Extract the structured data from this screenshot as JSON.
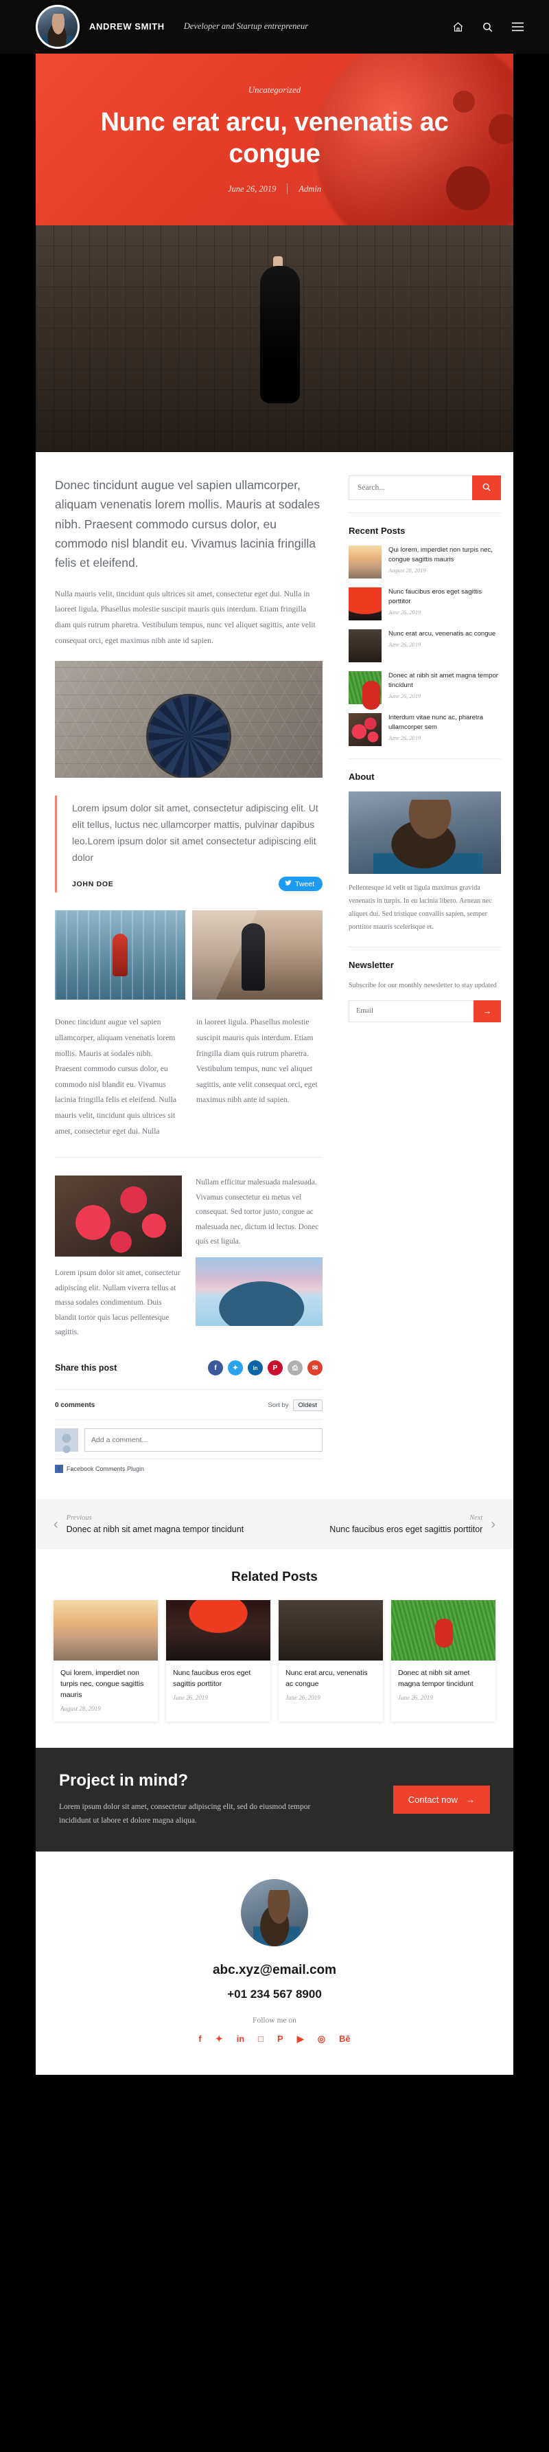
{
  "header": {
    "brand_name": "ANDREW SMITH",
    "brand_tagline": "Developer and Startup entrepreneur",
    "icons": {
      "home": "home-icon",
      "search": "search-icon",
      "menu": "hamburger-menu-icon"
    }
  },
  "hero": {
    "category": "Uncategorized",
    "title": "Nunc erat arcu, venenatis ac congue",
    "date": "June 26, 2019",
    "author": "Admin"
  },
  "article": {
    "lead": "Donec tincidunt augue vel sapien ullamcorper, aliquam venenatis lorem mollis. Mauris at sodales nibh. Praesent commodo cursus dolor, eu commodo nisl blandit eu. Vivamus lacinia fringilla felis et eleifend.",
    "para1": "Nulla mauris velit, tincidunt quis ultrices sit amet, consectetur eget dui. Nulla in laoreet ligula. Phasellus molestie suscipit mauris quis interdum. Etiam fringilla diam quis rutrum pharetra. Vestibulum tempus, nunc vel aliquet sagittis, ante velit consequat orci, eget maximus nibh ante id sapien.",
    "quote": "Lorem ipsum dolor sit amet, consectetur adipiscing elit. Ut elit tellus, luctus nec ullamcorper mattis, pulvinar dapibus leo.Lorem ipsum dolor sit amet consectetur adipiscing elit dolor",
    "quote_author": "JOHN DOE",
    "tweet_label": "Tweet",
    "col_left": "Donec tincidunt augue vel sapien ullamcorper, aliquam venenatis lorem mollis. Mauris at sodales nibh. Praesent commodo cursus dolor, eu commodo nisl blandit eu. Vivamus lacinia fringilla felis et eleifend. Nulla mauris velit, tincidunt quis ultrices sit amet, consectetur eget dui. Nulla",
    "col_right": "in laoreet ligula. Phasellus molestie suscipit mauris quis interdum. Etiam fringilla diam quis rutrum pharetra. Vestibulum tempus, nunc vel aliquet sagittis, ante velit consequat orci, eget maximus nibh ante id sapien.",
    "mac_caption": "Lorem ipsum dolor sit amet, consectetur adipiscing elit. Nullam viverra tellus at massa sodales condimentum. Duis blandit tortor quis lacus pellentesque sagittis.",
    "mac_right_text": "Nullam efficitur malesuada malesuada. Vivamus consectetur eu metus vel consequat. Sed tortor justo, congue ac malesuada nec, dictum id lectus. Donec quis est ligula.",
    "share_label": "Share this post",
    "share_icons": [
      {
        "name": "facebook-share-icon",
        "glyph": "f",
        "color": "#3b5998"
      },
      {
        "name": "twitter-share-icon",
        "glyph": "✦",
        "color": "#2aa3ef"
      },
      {
        "name": "linkedin-share-icon",
        "glyph": "in",
        "color": "#0a66a8"
      },
      {
        "name": "pinterest-share-icon",
        "glyph": "P",
        "color": "#c8102e"
      },
      {
        "name": "print-share-icon",
        "glyph": "⎙",
        "color": "#b0b0b0"
      },
      {
        "name": "email-share-icon",
        "glyph": "✉",
        "color": "#e0402c"
      }
    ]
  },
  "comments": {
    "count_label": "0 comments",
    "sort_label": "Sort by",
    "sort_value": "Oldest",
    "input_placeholder": "Add a comment...",
    "plugin_label": "Facebook Comments Plugin"
  },
  "prevnext": {
    "prev_kicker": "Previous",
    "prev_title": "Donec at nibh sit amet magna tempor tincidunt",
    "next_kicker": "Next",
    "next_title": "Nunc faucibus eros eget sagittis porttitor"
  },
  "related": {
    "heading": "Related Posts",
    "items": [
      {
        "title": "Qui lorem, imperdiet non turpis nec, congue sagittis mauris",
        "date": "August 28, 2019",
        "thumb": "th-beach"
      },
      {
        "title": "Nunc faucibus eros eget sagittis porttitor",
        "date": "June 26, 2019",
        "thumb": "th-metro"
      },
      {
        "title": "Nunc erat arcu, venenatis ac congue",
        "date": "June 26, 2019",
        "thumb": "th-girl"
      },
      {
        "title": "Donec at nibh sit amet magna tempor tincidunt",
        "date": "June 26, 2019",
        "thumb": "th-grass"
      }
    ]
  },
  "sidebar": {
    "search_placeholder": "Search...",
    "search_icon": "search-icon",
    "recent_title": "Recent Posts",
    "recent_posts": [
      {
        "title": "Qui lorem, imperdiet non turpis nec, congue sagittis mauris",
        "date": "August 28, 2019",
        "thumb": "th-beach"
      },
      {
        "title": "Nunc faucibus eros eget sagittis porttitor",
        "date": "June 26, 2019",
        "thumb": "th-metro"
      },
      {
        "title": "Nunc erat arcu, venenatis ac congue",
        "date": "June 26, 2019",
        "thumb": "th-girl"
      },
      {
        "title": "Donec at nibh sit amet magna tempor tincidunt",
        "date": "June 26, 2019",
        "thumb": "th-grass"
      },
      {
        "title": "Interdum vitae nunc ac, pharetra ullamcorper sem",
        "date": "June 26, 2019",
        "thumb": "th-macaron"
      }
    ],
    "about_title": "About",
    "about_text": "Pellentesque id velit ut ligula maximus gravida venenatis in turpis. In eu lacinia libero. Aenean nec aliquet dui. Sed tristique convallis sapien, semper porttitor mauris scelerisque et.",
    "newsletter_title": "Newsletter",
    "newsletter_text": "Subscribe for our monthly newsletter to stay updated",
    "newsletter_placeholder": "Email",
    "newsletter_button": "→"
  },
  "cta": {
    "heading": "Project in mind?",
    "text": "Lorem ipsum dolor sit amet, consectetur adipiscing elit, sed do eiusmod tempor incididunt ut labore et dolore magna aliqua.",
    "button": "Contact now",
    "button_arrow": "→"
  },
  "footer": {
    "email": "abc.xyz@email.com",
    "phone": "+01 234 567 8900",
    "follow_label": "Follow me on",
    "social": [
      {
        "name": "facebook-icon",
        "glyph": "f"
      },
      {
        "name": "twitter-icon",
        "glyph": "✦"
      },
      {
        "name": "linkedin-icon",
        "glyph": "in"
      },
      {
        "name": "instagram-icon",
        "glyph": "□"
      },
      {
        "name": "pinterest-icon",
        "glyph": "P"
      },
      {
        "name": "youtube-icon",
        "glyph": "▶"
      },
      {
        "name": "dribbble-icon",
        "glyph": "◎"
      },
      {
        "name": "behance-icon",
        "glyph": "Bē"
      }
    ]
  },
  "colors": {
    "accent": "#ef412c",
    "dark": "#2b2b2b",
    "header_bg": "#0b0b0b"
  }
}
